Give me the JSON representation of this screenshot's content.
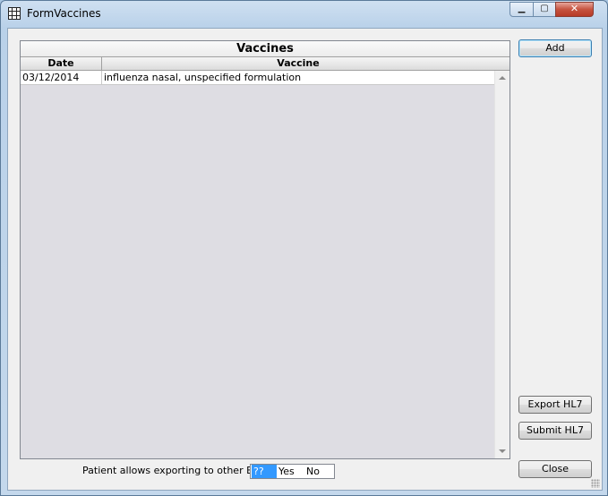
{
  "window": {
    "title": "FormVaccines"
  },
  "title_controls": {
    "minimize": "▁",
    "maximize": "▢",
    "close": "✕"
  },
  "grid": {
    "title": "Vaccines",
    "columns": [
      "Date",
      "Vaccine"
    ],
    "rows": [
      {
        "date": "03/12/2014",
        "vaccine": "influenza nasal, unspecified formulation"
      }
    ]
  },
  "buttons": {
    "add": "Add",
    "export_hl7": "Export HL7",
    "submit_hl7": "Submit HL7",
    "close": "Close"
  },
  "export_option": {
    "label": "Patient allows exporting to other EHRs",
    "options": [
      "??",
      "Yes",
      "No"
    ],
    "selected": "??"
  }
}
